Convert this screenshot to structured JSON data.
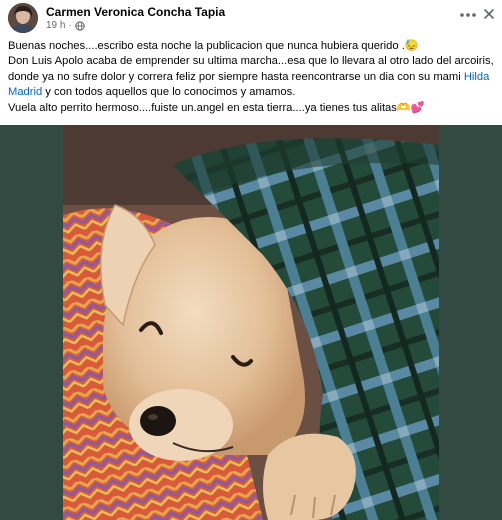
{
  "post": {
    "author": "Carmen Veronica Concha Tapia",
    "timestamp": "19 h",
    "separator": "·",
    "audience_icon": "globe-icon",
    "lines": {
      "l1": "Buenas noches....escribo esta noche la publicacion que nunca hubiera querido .",
      "l1_emoji": "😓",
      "l2": "Don Luis Apolo acaba de emprender su ultima marcha...esa que lo llevara al otro lado del arcoiris,",
      "l3a": "donde ya no sufre dolor y correra feliz por siempre hasta reencontrarse un dia con su mami ",
      "l3_mention": "Hilda",
      "l4_mention": "Madrid",
      "l4b": " y con todos aquellos que lo conocimos y amamos.",
      "l5": "Vuela alto perrito hermoso....fuiste un.angel en esta tierra....ya tienes tus alitas",
      "l5_emoji": "🫶💕"
    }
  },
  "icons": {
    "more": "more-options-icon",
    "close": "close-icon"
  },
  "colors": {
    "mention": "#0064d1",
    "secondary_text": "#65676b",
    "media_background": "#334a43"
  }
}
